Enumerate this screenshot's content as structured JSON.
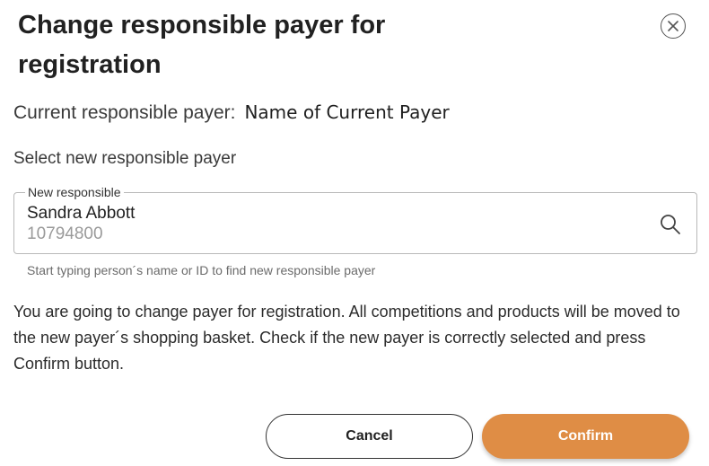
{
  "dialog": {
    "title": "Change responsible payer for registration",
    "current_payer_label": "Current responsible payer:",
    "current_payer_value": "Name of Current Payer",
    "select_label": "Select new responsible payer",
    "field": {
      "legend": "New responsible",
      "name": "Sandra Abbott",
      "id": "10794800",
      "helper": "Start typing person´s name or ID to find new responsible payer"
    },
    "info_text": "You are going to change payer for registration. All competitions and products will be moved to the new payer´s shopping basket. Check if the new payer is correctly selected and press Confirm button.",
    "buttons": {
      "cancel": "Cancel",
      "confirm": "Confirm"
    },
    "colors": {
      "confirm_bg": "#df8d45",
      "text": "#222222"
    },
    "icons": {
      "close": "close-circle-icon",
      "search": "search-icon"
    }
  }
}
